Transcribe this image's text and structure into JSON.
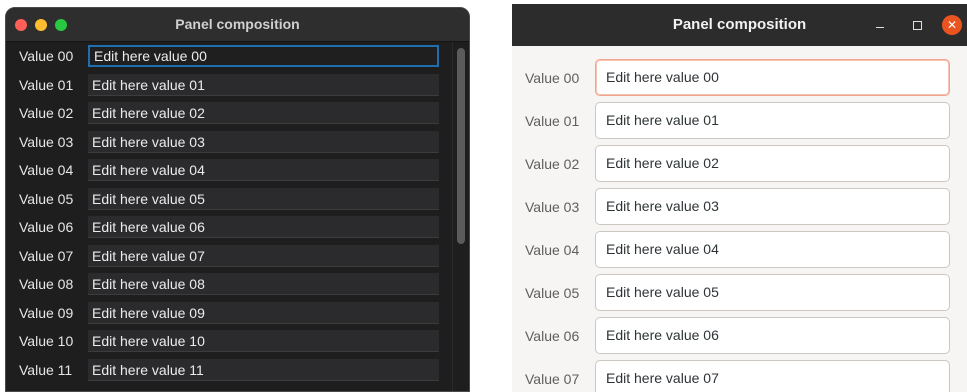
{
  "mac_window": {
    "title": "Panel composition",
    "rows": [
      {
        "label": "Value 00",
        "value": "Edit here value 00"
      },
      {
        "label": "Value 01",
        "value": "Edit here value 01"
      },
      {
        "label": "Value 02",
        "value": "Edit here value 02"
      },
      {
        "label": "Value 03",
        "value": "Edit here value 03"
      },
      {
        "label": "Value 04",
        "value": "Edit here value 04"
      },
      {
        "label": "Value 05",
        "value": "Edit here value 05"
      },
      {
        "label": "Value 06",
        "value": "Edit here value 06"
      },
      {
        "label": "Value 07",
        "value": "Edit here value 07"
      },
      {
        "label": "Value 08",
        "value": "Edit here value 08"
      },
      {
        "label": "Value 09",
        "value": "Edit here value 09"
      },
      {
        "label": "Value 10",
        "value": "Edit here value 10"
      },
      {
        "label": "Value 11",
        "value": "Edit here value 11"
      }
    ],
    "colors": {
      "close": "#fe5f57",
      "minimize": "#febc2e",
      "maximize": "#28c840",
      "focus": "#1f6fb0"
    }
  },
  "gtk_window": {
    "title": "Panel composition",
    "controls": {
      "minimize": "–",
      "maximize": "□",
      "close": "×"
    },
    "rows": [
      {
        "label": "Value 00",
        "value": "Edit here value 00"
      },
      {
        "label": "Value 01",
        "value": "Edit here value 01"
      },
      {
        "label": "Value 02",
        "value": "Edit here value 02"
      },
      {
        "label": "Value 03",
        "value": "Edit here value 03"
      },
      {
        "label": "Value 04",
        "value": "Edit here value 04"
      },
      {
        "label": "Value 05",
        "value": "Edit here value 05"
      },
      {
        "label": "Value 06",
        "value": "Edit here value 06"
      },
      {
        "label": "Value 07",
        "value": "Edit here value 07"
      }
    ],
    "colors": {
      "close": "#e95420",
      "focus": "#f0a48b"
    }
  }
}
